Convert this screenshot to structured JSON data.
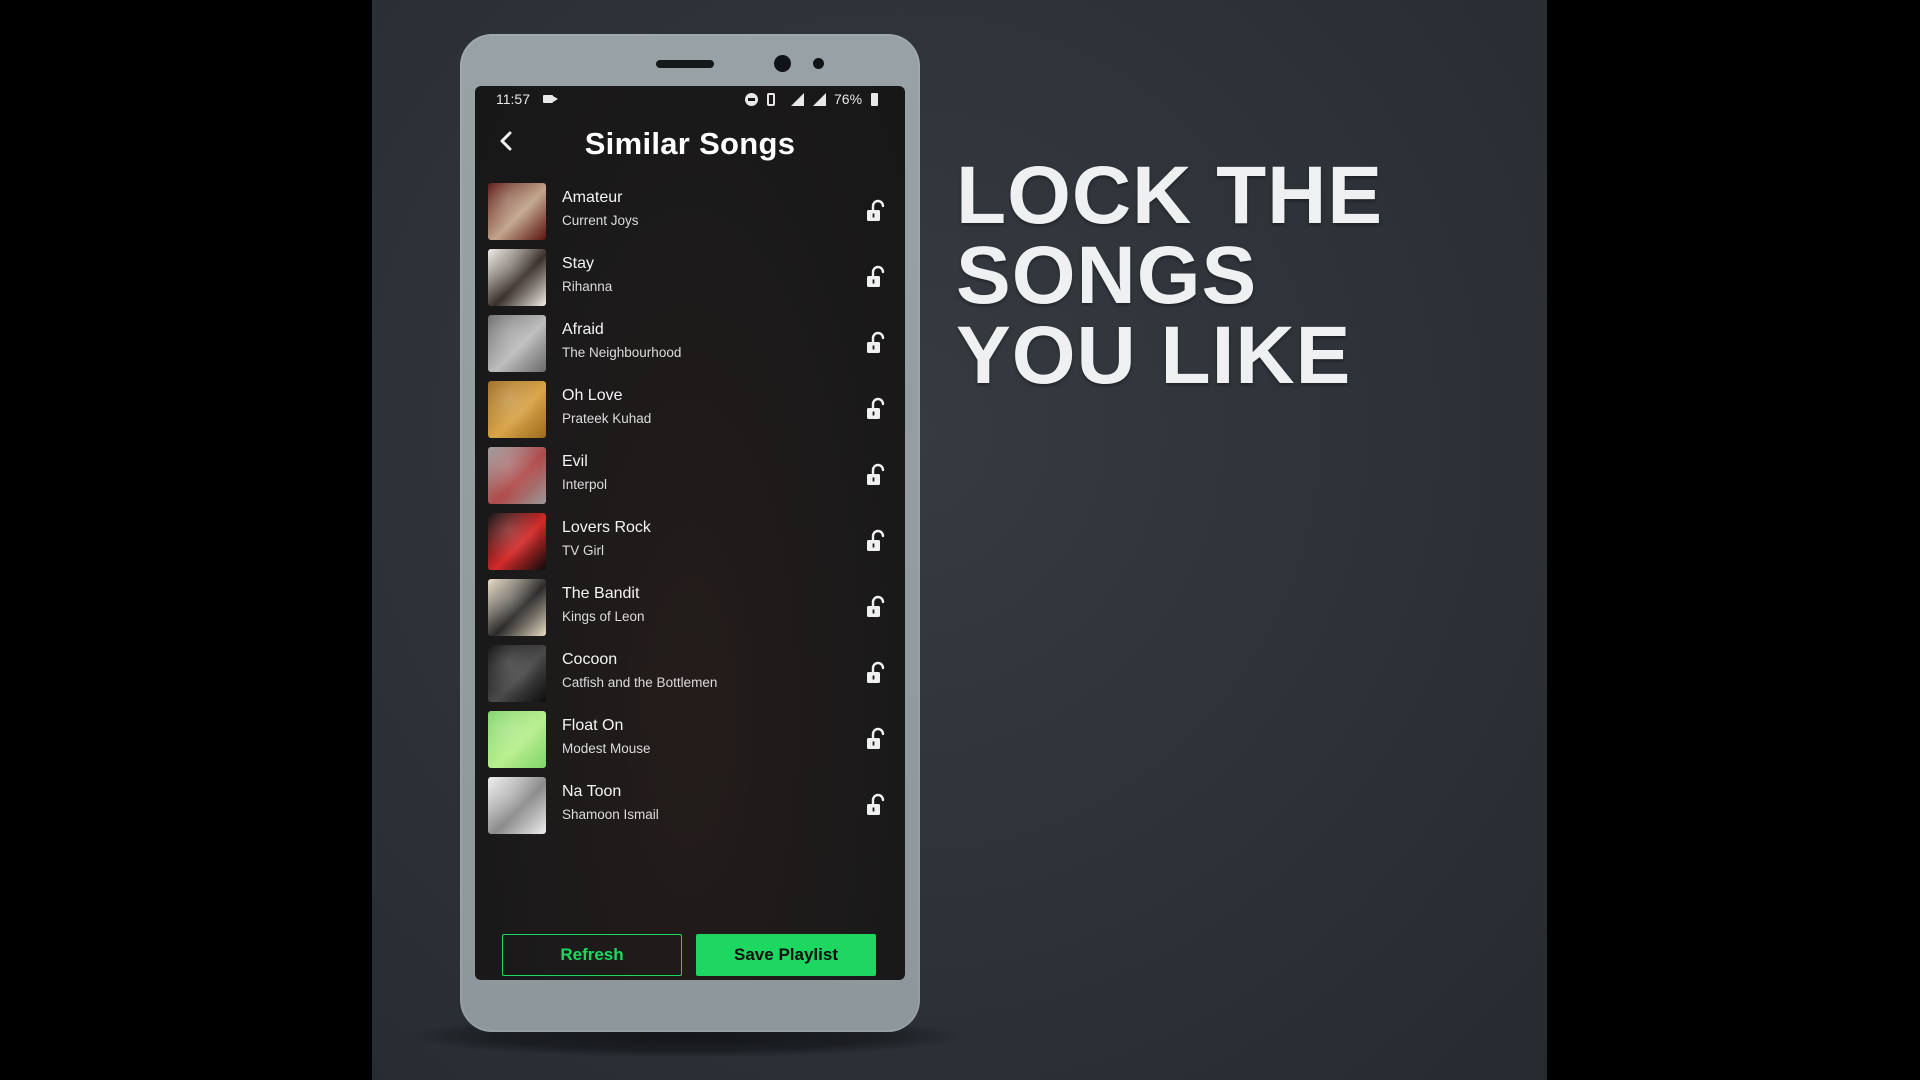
{
  "statusbar": {
    "time": "11:57",
    "battery": "76%",
    "icons": [
      "video-record-icon",
      "do-not-disturb-icon",
      "vibrate-icon",
      "signal-icon",
      "signal-icon",
      "battery-icon"
    ]
  },
  "screen": {
    "title": "Similar Songs",
    "back_icon": "chevron-left-icon"
  },
  "songs": [
    {
      "title": "Amateur",
      "artist": "Current Joys",
      "art_colors": [
        "#5a1410",
        "#c2a58c"
      ],
      "locked": false
    },
    {
      "title": "Stay",
      "artist": "Rihanna",
      "art_colors": [
        "#f2eee8",
        "#3a2f2a"
      ],
      "locked": false
    },
    {
      "title": "Afraid",
      "artist": "The Neighbourhood",
      "art_colors": [
        "#6a6a6a",
        "#bdbdbd"
      ],
      "locked": false
    },
    {
      "title": "Oh Love",
      "artist": "Prateek Kuhad",
      "art_colors": [
        "#9b6a1c",
        "#d9a449"
      ],
      "locked": false
    },
    {
      "title": "Evil",
      "artist": "Interpol",
      "art_colors": [
        "#9a9a9a",
        "#b04a4a"
      ],
      "locked": false
    },
    {
      "title": "Lovers Rock",
      "artist": "TV Girl",
      "art_colors": [
        "#0a0a0a",
        "#d42a2a"
      ],
      "locked": false
    },
    {
      "title": "The Bandit",
      "artist": "Kings of Leon",
      "art_colors": [
        "#e8dcc4",
        "#2a2a2a"
      ],
      "locked": false
    },
    {
      "title": "Cocoon",
      "artist": "Catfish and the Bottlemen",
      "art_colors": [
        "#0c0c0c",
        "#4a4a4a"
      ],
      "locked": false
    },
    {
      "title": "Float On",
      "artist": "Modest Mouse",
      "art_colors": [
        "#7fd46a",
        "#b9ef8e"
      ],
      "locked": false
    },
    {
      "title": "Na Toon",
      "artist": "Shamoon Ismail",
      "art_colors": [
        "#f0f0f0",
        "#8a8a8a"
      ],
      "locked": false
    }
  ],
  "lock_icon": "unlocked-padlock-icon",
  "buttons": {
    "refresh": "Refresh",
    "save": "Save Playlist"
  },
  "promo": {
    "lines": [
      "LOCK THE",
      "SONGS",
      "YOU LIKE"
    ]
  },
  "colors": {
    "accent": "#1ed760",
    "stage_bg": "#2d3238",
    "phone_body": "#949ea2",
    "screen_bg": "#1b1b1b"
  }
}
